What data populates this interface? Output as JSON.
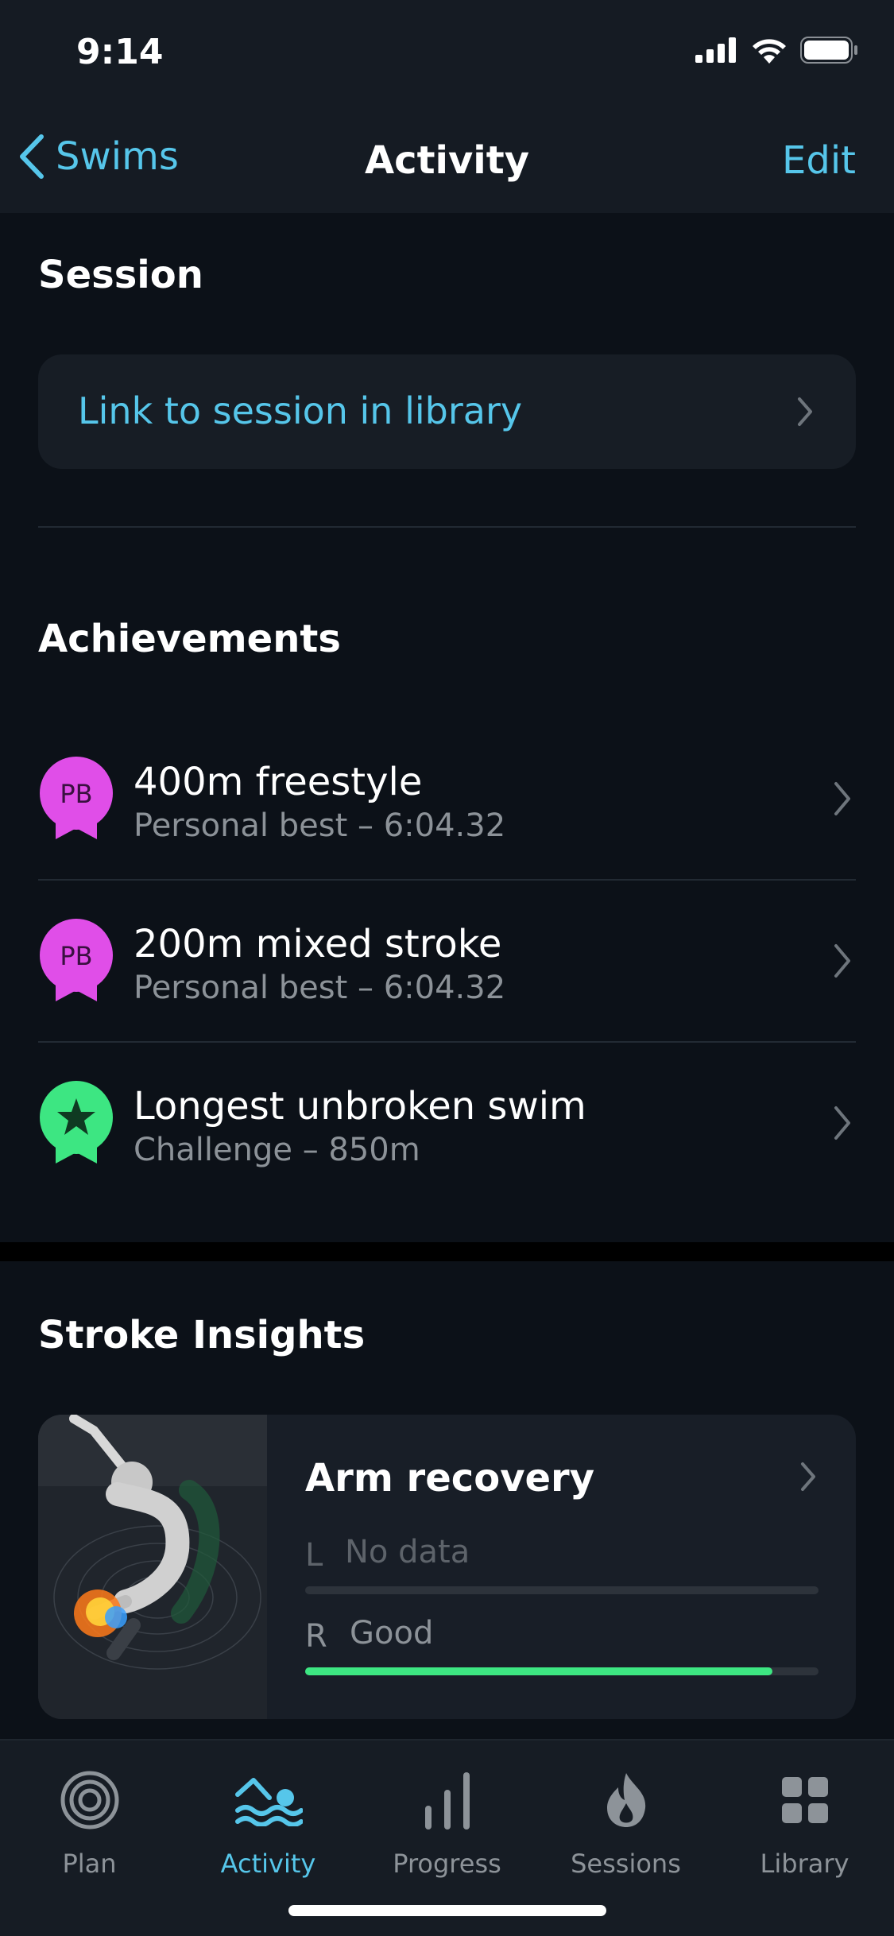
{
  "status_bar": {
    "time": "9:14"
  },
  "nav": {
    "back_label": "Swims",
    "title": "Activity",
    "edit_label": "Edit"
  },
  "session": {
    "title": "Session",
    "link_label": "Link to session in library"
  },
  "achievements": {
    "title": "Achievements",
    "items": [
      {
        "badge": "PB",
        "badge_color": "#e04ee8",
        "title": "400m freestyle",
        "subtitle": "Personal best – 6:04.32"
      },
      {
        "badge": "PB",
        "badge_color": "#e04ee8",
        "title": "200m mixed stroke",
        "subtitle": "Personal best – 6:04.32"
      },
      {
        "badge": "star-icon",
        "badge_color": "#3de682",
        "title": "Longest unbroken swim",
        "subtitle": "Challenge – 850m"
      }
    ]
  },
  "stroke_insights": {
    "title": "Stroke Insights",
    "card": {
      "title": "Arm recovery",
      "left": {
        "side": "L",
        "value": "No data",
        "fraction": 0
      },
      "right": {
        "side": "R",
        "value": "Good",
        "fraction": 0.91
      }
    }
  },
  "tabs": [
    {
      "label": "Plan",
      "icon": "target-icon",
      "active": false
    },
    {
      "label": "Activity",
      "icon": "swimmer-icon",
      "active": true
    },
    {
      "label": "Progress",
      "icon": "bars-icon",
      "active": false
    },
    {
      "label": "Sessions",
      "icon": "flame-icon",
      "active": false
    },
    {
      "label": "Library",
      "icon": "grid-icon",
      "active": false
    }
  ],
  "colors": {
    "accent": "#56c6ea",
    "good": "#3de682",
    "pb": "#e04ee8"
  }
}
